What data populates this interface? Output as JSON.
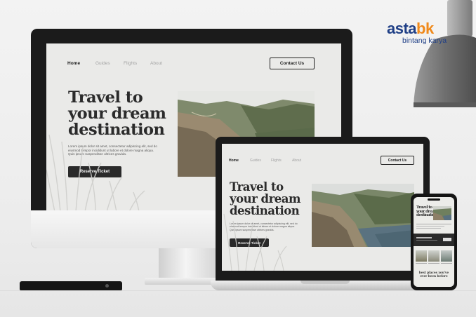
{
  "brand": {
    "word_a": "asta",
    "word_b": "bk",
    "sub": "bintang karya"
  },
  "site": {
    "nav": {
      "home": "Home",
      "guides": "Guides",
      "flights": "Flights",
      "about": "About"
    },
    "contact_label": "Contact Us",
    "hero_title_lines": [
      "Travel to",
      "your dream",
      "destination"
    ],
    "body_lines": [
      "Lorem ipsum dolor sit amet, consectetur adipiscing elit, sed do",
      "eiusmod tempor incididunt ut labore et dolore magna aliqua.",
      "Quis ipsum suspendisse ultrices gravida."
    ],
    "reserve_label": "Reserve Ticket"
  },
  "phone": {
    "title_lines": [
      "Travel to",
      "your dream",
      "destination"
    ],
    "footer_lines": [
      "best places you've",
      "ever been before"
    ]
  },
  "colors": {
    "brand_blue": "#1f3f86",
    "brand_orange": "#f08a1c",
    "site_bg": "#eaeae8",
    "dark": "#2a2a2a"
  }
}
